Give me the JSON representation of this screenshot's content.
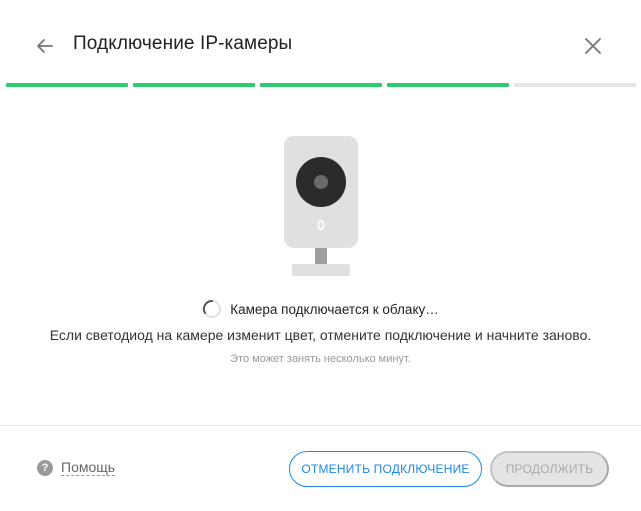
{
  "header": {
    "title": "Подключение IP-камеры",
    "back_icon": "arrow-left-icon",
    "close_icon": "close-icon"
  },
  "progress": {
    "total_steps": 5,
    "completed_steps": 4,
    "completed_color": "#2ecc71",
    "pending_color": "#e6e6e6"
  },
  "camera": {
    "icon": "ip-camera-icon",
    "body_color": "#e0e0e0",
    "lens_color": "#2b2b2b"
  },
  "status": {
    "text": "Камера подключается к облаку…",
    "spinner_icon": "loading-spinner-icon"
  },
  "info": {
    "text": "Если светодиод на камере изменит цвет, отмените подключение и начните заново.",
    "hint": "Это может занять несколько минут."
  },
  "footer": {
    "help_label": "Помощь",
    "help_icon": "question-icon",
    "cancel_label": "ОТМЕНИТЬ ПОДКЛЮЧЕНИЕ",
    "continue_label": "ПРОДОЛЖИТЬ",
    "accent_color": "#1e88e5"
  }
}
